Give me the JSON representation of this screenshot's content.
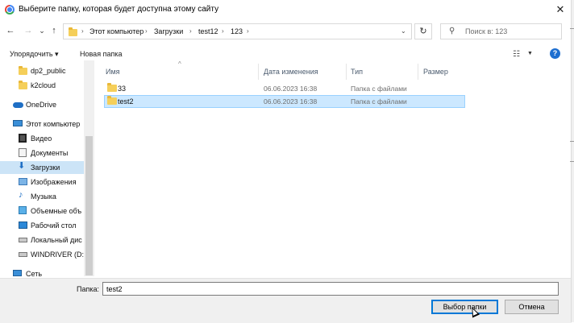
{
  "window": {
    "title": "Выберите папку, которая будет доступна этому сайту",
    "close_glyph": "✕"
  },
  "address": {
    "breadcrumbs": [
      "Этот компьютер",
      "Загрузки",
      "test12",
      "123"
    ],
    "separator": "›",
    "nav_back": "←",
    "nav_forward": "→",
    "nav_recent": "⌄",
    "nav_up": "↑",
    "dropdown": "⌄",
    "refresh_glyph": "↻",
    "search_placeholder": "Поиск в: 123"
  },
  "toolbar": {
    "organize": "Упорядочить ▾",
    "new_folder": "Новая папка",
    "view_glyph": "☷",
    "view_dd": "▼",
    "help": "?"
  },
  "sidebar": {
    "items": [
      {
        "label": "dp2_public",
        "icon": "folder-icon"
      },
      {
        "label": "k2cloud",
        "icon": "folder-icon"
      },
      {
        "label": "OneDrive",
        "icon": "cloud-icon"
      },
      {
        "label": "Этот компьютер",
        "icon": "computer-icon"
      },
      {
        "label": "Видео",
        "icon": "video-icon"
      },
      {
        "label": "Документы",
        "icon": "documents-icon"
      },
      {
        "label": "Загрузки",
        "icon": "download-icon",
        "selected": true
      },
      {
        "label": "Изображения",
        "icon": "pictures-icon"
      },
      {
        "label": "Музыка",
        "icon": "music-icon"
      },
      {
        "label": "Объемные объ",
        "icon": "3d-objects-icon"
      },
      {
        "label": "Рабочий стол",
        "icon": "desktop-icon"
      },
      {
        "label": "Локальный дис",
        "icon": "drive-icon"
      },
      {
        "label": "WINDRIVER (D:)",
        "icon": "drive-icon"
      },
      {
        "label": "Сеть",
        "icon": "network-icon"
      }
    ]
  },
  "columns": {
    "name": "Имя",
    "date": "Дата изменения",
    "type": "Тип",
    "size": "Размер",
    "sort_caret": "^"
  },
  "files": [
    {
      "name": "33",
      "date": "06.06.2023 16:38",
      "type": "Папка с файлами"
    },
    {
      "name": "test2",
      "date": "06.06.2023 16:38",
      "type": "Папка с файлами",
      "selected": true
    }
  ],
  "footer": {
    "folder_label": "Папка:",
    "folder_value": "test2",
    "select_button": "Выбор папки",
    "cancel_button": "Отмена"
  },
  "colors": {
    "selection": "#cce8ff",
    "accent": "#0078d7",
    "folder": "#f5cf5a"
  }
}
